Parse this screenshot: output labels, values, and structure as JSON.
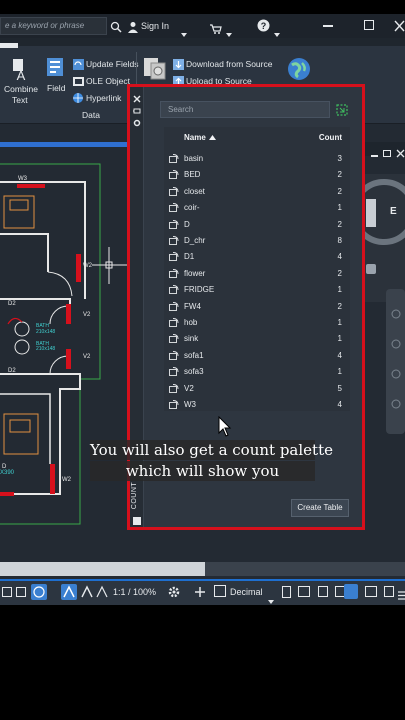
{
  "titlebar": {
    "search_placeholder": "e a keyword or phrase",
    "sign_in": "Sign In"
  },
  "ribbon": {
    "combine_text": "Combine",
    "combine_text2": "Text",
    "field": "Field",
    "update_fields": "Update Fields",
    "ole_object": "OLE Object",
    "hyperlink": "Hyperlink",
    "data_group": "Data",
    "download_from_source": "Download from Source",
    "upload_to_source": "Upload to Source"
  },
  "palette": {
    "title": "COUNT",
    "search_placeholder": "Search",
    "col_name": "Name",
    "col_count": "Count",
    "items": [
      {
        "name": "basin",
        "count": "3"
      },
      {
        "name": "BED",
        "count": "2"
      },
      {
        "name": "closet",
        "count": "2"
      },
      {
        "name": "coir-",
        "count": "1"
      },
      {
        "name": "D",
        "count": "2"
      },
      {
        "name": "D_chr",
        "count": "8"
      },
      {
        "name": "D1",
        "count": "4"
      },
      {
        "name": "flower",
        "count": "2"
      },
      {
        "name": "FRIDGE",
        "count": "1"
      },
      {
        "name": "FW4",
        "count": "2"
      },
      {
        "name": "hob",
        "count": "1"
      },
      {
        "name": "sink",
        "count": "1"
      },
      {
        "name": "sofa1",
        "count": "4"
      },
      {
        "name": "sofa3",
        "count": "1"
      },
      {
        "name": "V2",
        "count": "5"
      },
      {
        "name": "W3",
        "count": "4"
      }
    ],
    "create_table": "Create Table"
  },
  "drawing": {
    "labels": {
      "w3": "W3",
      "w2a": "W2",
      "w2b": "W2",
      "d2a": "D2",
      "d2b": "D2",
      "v2a": "V2",
      "v2b": "V2",
      "bath1": "BATH",
      "bath1_size": "210x148",
      "bath2": "BATH",
      "bath2_size": "210x148",
      "d_lbl": "D",
      "dim1": "X390"
    }
  },
  "statusbar": {
    "scale": "1:1 / 100%",
    "units": "Decimal"
  },
  "caption": {
    "line1": "You will also get a count palette",
    "line2": "which will show you"
  },
  "colors": {
    "accent_red": "#d6101c",
    "accent_blue": "#1e6fd0",
    "panel": "#2e3640"
  }
}
